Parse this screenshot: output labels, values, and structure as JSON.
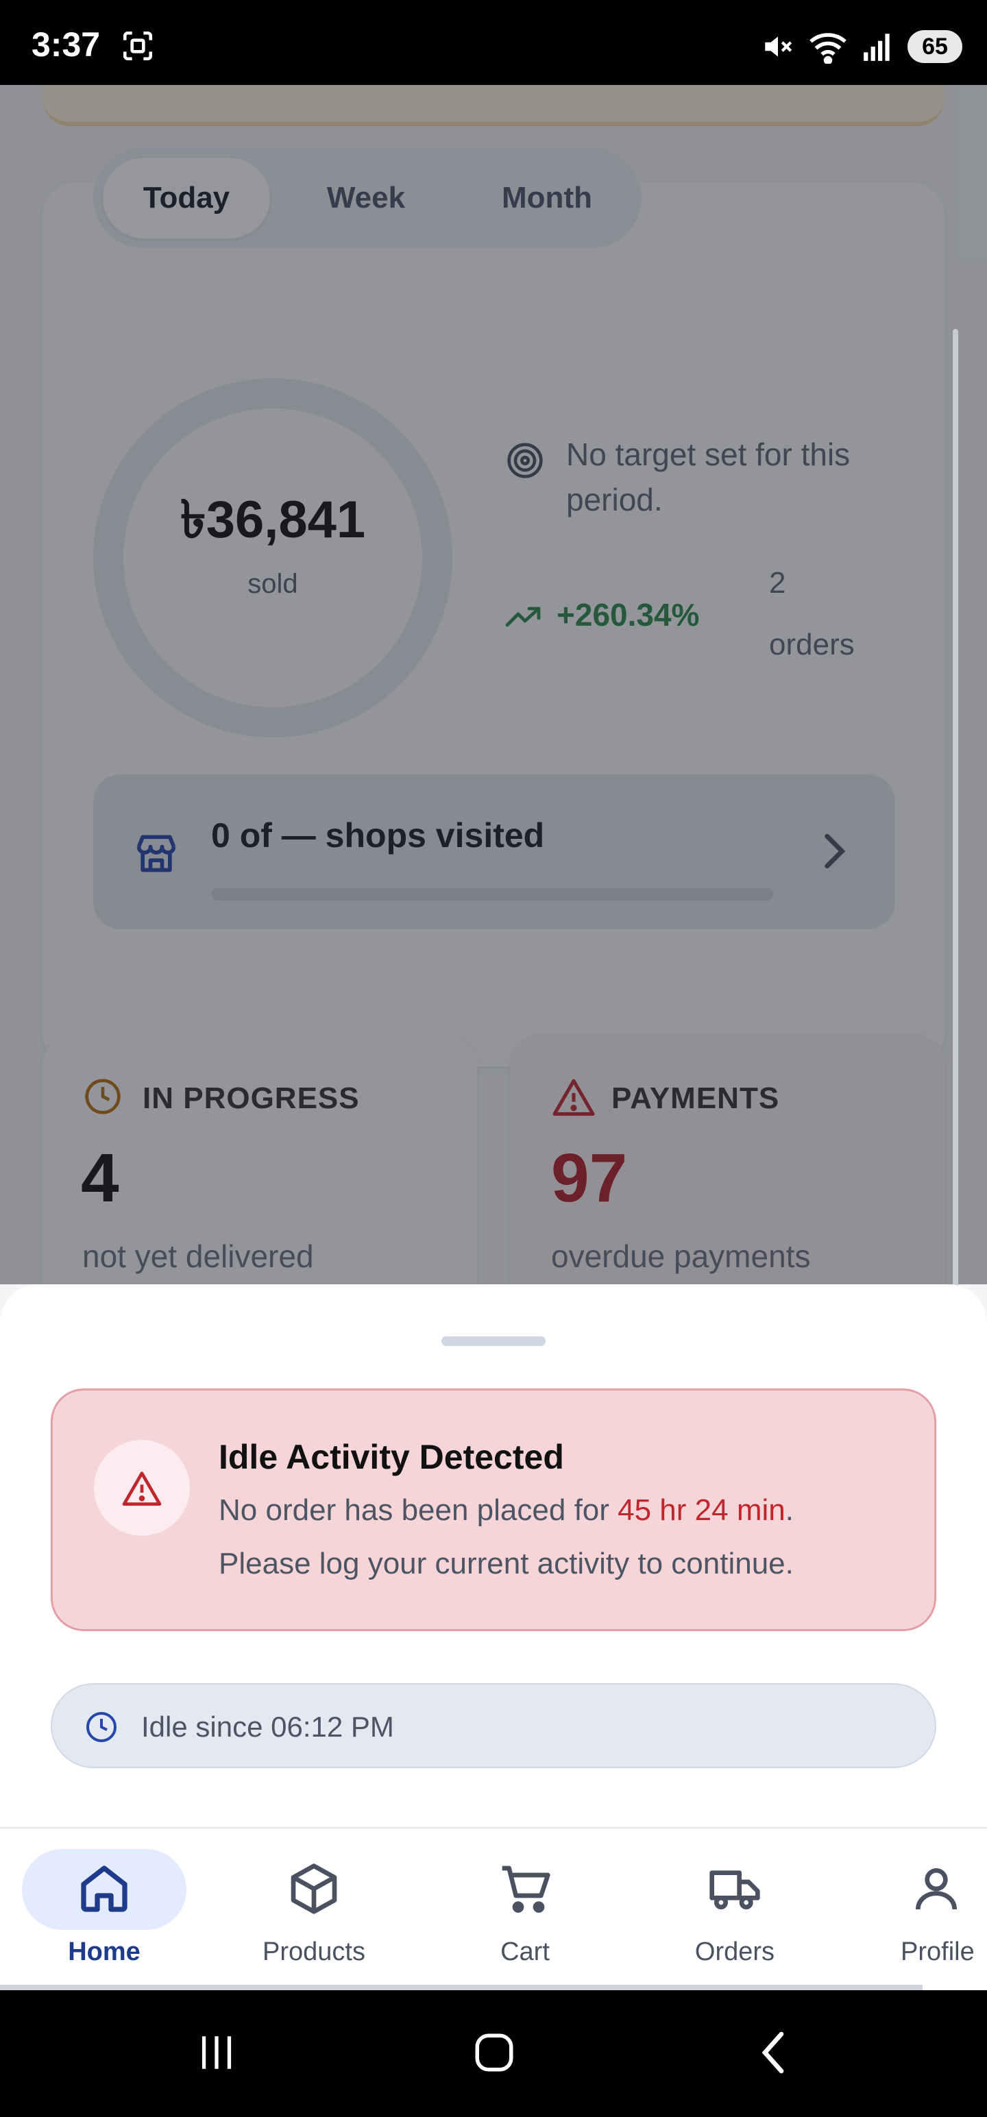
{
  "status_bar": {
    "time": "3:37",
    "battery": "65",
    "icons": [
      "screenshot-icon",
      "mute-icon",
      "wifi-icon",
      "signal-icon",
      "battery-icon"
    ]
  },
  "sales_card": {
    "tabs": [
      {
        "label": "Today",
        "active": true
      },
      {
        "label": "Week",
        "active": false
      },
      {
        "label": "Month",
        "active": false
      }
    ],
    "amount": "৳36,841",
    "amount_caption": "sold",
    "target_text": "No target set for this period.",
    "growth": "+260.34%",
    "orders_count": "2",
    "orders_label": "orders",
    "shops_visited": "0 of — shops visited",
    "shops_progress": 0
  },
  "stats": {
    "in_progress": {
      "title": "IN PROGRESS",
      "value": "4",
      "subtitle": "not yet delivered"
    },
    "payments": {
      "title": "PAYMENTS",
      "value": "97",
      "subtitle": "overdue payments"
    }
  },
  "sheet": {
    "alert_title": "Idle Activity Detected",
    "alert_msg_prefix": "No order has been placed for ",
    "alert_msg_highlight": "45 hr 24 min",
    "alert_msg_suffix": ".",
    "alert_msg_line2": "Please log your current activity to continue.",
    "idle_since": "Idle since 06:12 PM"
  },
  "bottom_nav": {
    "items": [
      {
        "label": "Home",
        "icon": "home-icon",
        "active": true
      },
      {
        "label": "Products",
        "icon": "box-icon",
        "active": false
      },
      {
        "label": "Cart",
        "icon": "cart-icon",
        "active": false
      },
      {
        "label": "Orders",
        "icon": "truck-icon",
        "active": false
      },
      {
        "label": "Profile",
        "icon": "user-icon",
        "active": false
      }
    ]
  },
  "colors": {
    "accent": "#1e3a8a",
    "growth": "#2f8a4b",
    "danger": "#c0262d",
    "alert_bg": "#f6d5d8"
  }
}
